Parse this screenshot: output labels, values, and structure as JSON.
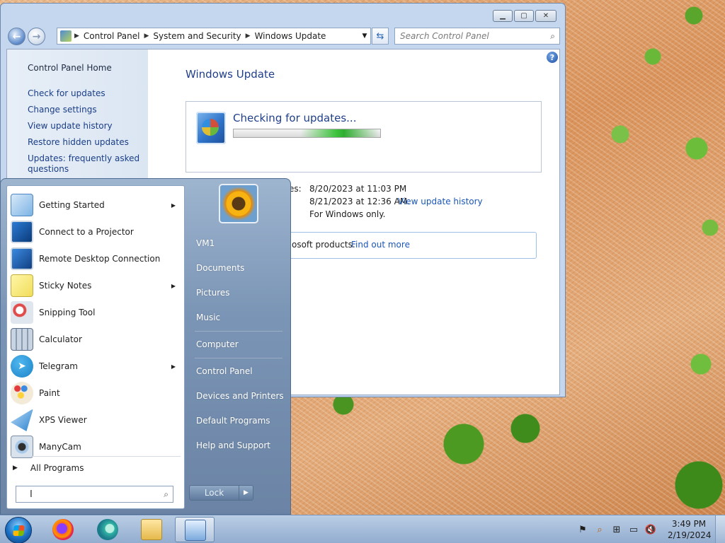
{
  "window": {
    "address_crumbs": [
      "Control Panel",
      "System and Security",
      "Windows Update"
    ],
    "search_placeholder": "Search Control Panel",
    "left_links": {
      "home": "Control Panel Home",
      "check": "Check for updates",
      "change": "Change settings",
      "history": "View update history",
      "restore": "Restore hidden updates",
      "faq_line1": "Updates: frequently asked",
      "faq_line2": "questions"
    },
    "page_title": "Windows Update",
    "status": {
      "checking": "Checking for updates...",
      "progress_fraction": 0.5
    },
    "info": {
      "partial_label": "es:",
      "recent_check": "8/20/2023 at 11:03 PM",
      "installed": "8/21/2023 at 12:36 AM.",
      "history_link": "View update history",
      "receive": "For Windows only."
    },
    "notice": {
      "text": "osoft products.",
      "link": "Find out more"
    }
  },
  "start_menu": {
    "programs": [
      {
        "label": "Getting Started",
        "has_arrow": true,
        "icon": "getting-started-icon"
      },
      {
        "label": "Connect to a Projector",
        "has_arrow": false,
        "icon": "projector-icon"
      },
      {
        "label": "Remote Desktop Connection",
        "has_arrow": false,
        "icon": "remote-desktop-icon"
      },
      {
        "label": "Sticky Notes",
        "has_arrow": true,
        "icon": "sticky-notes-icon"
      },
      {
        "label": "Snipping Tool",
        "has_arrow": false,
        "icon": "snipping-tool-icon"
      },
      {
        "label": "Calculator",
        "has_arrow": false,
        "icon": "calculator-icon"
      },
      {
        "label": "Telegram",
        "has_arrow": true,
        "icon": "telegram-icon"
      },
      {
        "label": "Paint",
        "has_arrow": false,
        "icon": "paint-icon"
      },
      {
        "label": "XPS Viewer",
        "has_arrow": false,
        "icon": "xps-viewer-icon"
      },
      {
        "label": "ManyCam",
        "has_arrow": false,
        "icon": "manycam-icon"
      }
    ],
    "all_programs": "All Programs",
    "right_links": [
      "VM1",
      "Documents",
      "Pictures",
      "Music",
      "Computer",
      "Control Panel",
      "Devices and Printers",
      "Default Programs",
      "Help and Support"
    ],
    "lock_label": "Lock"
  },
  "taskbar": {
    "time": "3:49 PM",
    "date": "2/19/2024"
  },
  "colors": {
    "link": "#1a56b8",
    "title": "#1f3f8a",
    "progress": "#3fc43f"
  }
}
